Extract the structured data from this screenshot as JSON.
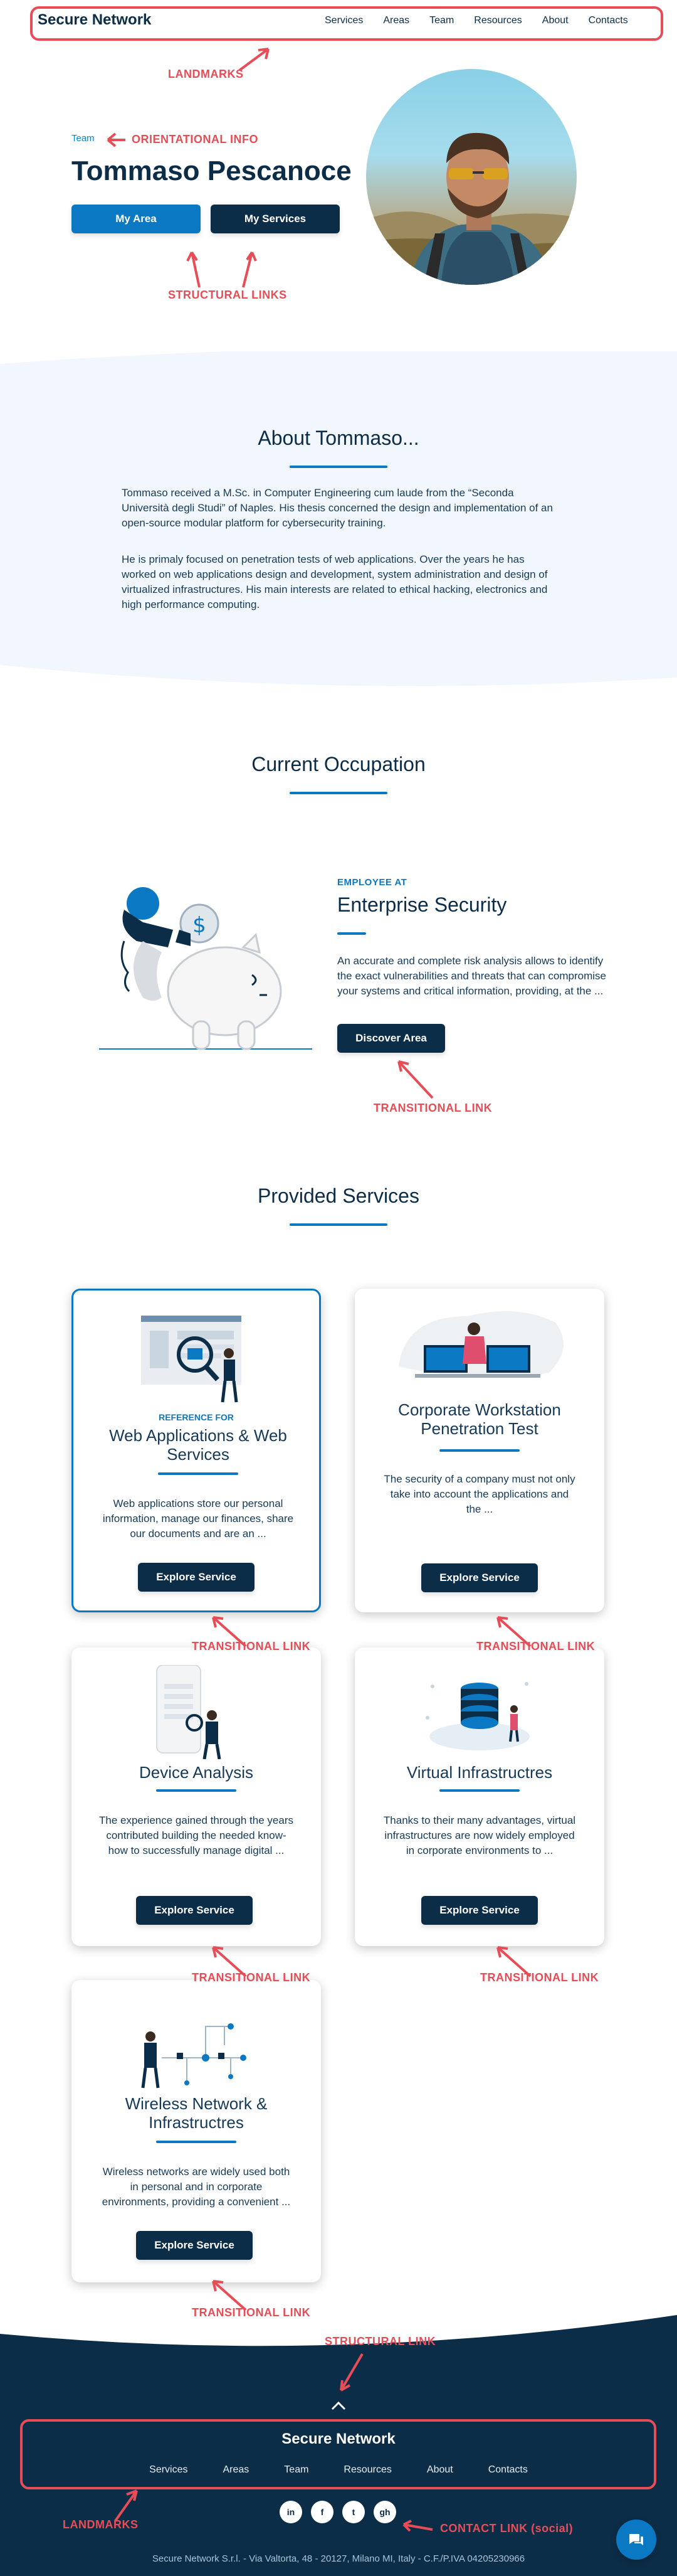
{
  "colors": {
    "brand_dark": "#0c2d48",
    "accent_blue": "#0a78c2",
    "annotation_red": "#e84d57",
    "section_bg": "#f1f7fc"
  },
  "header": {
    "brand": "Secure Network",
    "nav": [
      "Services",
      "Areas",
      "Team",
      "Resources",
      "About",
      "Contacts"
    ]
  },
  "hero": {
    "breadcrumb": "Team",
    "name": "Tommaso Pescanoce",
    "buttons": [
      "My Area",
      "My Services"
    ]
  },
  "about": {
    "title": "About Tommaso...",
    "paragraphs": [
      "Tommaso received a M.Sc. in Computer Engineering cum laude from the “Seconda Università degli Studi” of Naples. His thesis concerned the design and implementation of an open-source modular platform for cybersecurity training.",
      "He is primaly focused on penetration tests of web applications. Over the years he has worked on web applications design and development, system administration and design of virtualized infrastructures. His main interests are related to ethical hacking, electronics and high performance computing."
    ]
  },
  "occupation": {
    "title": "Current Occupation",
    "label": "EMPLOYEE AT",
    "company": "Enterprise Security",
    "text": "An accurate and complete risk analysis allows to identify the exact vulnerabilities and threats that can compromise your systems and critical information, providing, at the ...",
    "button": "Discover Area"
  },
  "services": {
    "title": "Provided Services",
    "cards": [
      {
        "ref": "REFERENCE FOR",
        "title": "Web Applications & Web Services",
        "text": "Web applications store our personal information, manage our finances, share our documents and are an ...",
        "button": "Explore Service"
      },
      {
        "title": "Corporate Workstation Penetration Test",
        "text": "The security of a company must not only take into account the applications and the ...",
        "button": "Explore Service"
      },
      {
        "title": "Device Analysis",
        "text": "The experience gained through the years contributed building the needed know-how to successfully manage digital ...",
        "button": "Explore Service"
      },
      {
        "title": "Virtual Infrastructres",
        "text": "Thanks to their many advantages, virtual infrastructures are now widely employed in corporate environments to ...",
        "button": "Explore Service"
      },
      {
        "title": "Wireless Network & Infrastructres",
        "text": "Wireless networks are widely used both in personal and in corporate environments, providing a convenient ...",
        "button": "Explore Service"
      }
    ]
  },
  "footer": {
    "brand": "Secure Network",
    "nav": [
      "Services",
      "Areas",
      "Team",
      "Resources",
      "About",
      "Contacts"
    ],
    "social": [
      {
        "icon": "linkedin-icon",
        "glyph": "in"
      },
      {
        "icon": "facebook-icon",
        "glyph": "f"
      },
      {
        "icon": "twitter-icon",
        "glyph": "t"
      },
      {
        "icon": "github-icon",
        "glyph": "gh"
      }
    ],
    "copyright": "Secure Network S.r.l. - Via Valtorta, 48 - 20127, Milano MI, Italy - C.F./P.IVA 04205230966"
  },
  "annotations": {
    "landmarks_top": "LANDMARKS",
    "orientational_info": "ORIENTATIONAL INFO",
    "structural_links_hero": "STRUCTURAL LINKS",
    "transitional_link": "TRANSITIONAL LINK",
    "structural_link_footer": "STRUCTURAL LINK",
    "landmarks_footer": "LANDMARKS",
    "contact_link_social": "CONTACT LINK (social)"
  }
}
